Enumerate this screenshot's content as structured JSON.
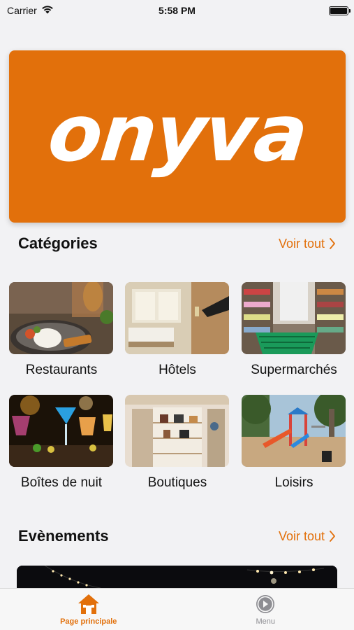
{
  "status_bar": {
    "carrier": "Carrier",
    "time": "5:58 PM"
  },
  "banner": {
    "logo_text": "onyva",
    "color": "#e2700b"
  },
  "categories_section": {
    "title": "Catégories",
    "see_all_label": "Voir tout",
    "items": [
      {
        "label": "Restaurants",
        "icon": "restaurant-photo"
      },
      {
        "label": "Hôtels",
        "icon": "hotel-photo"
      },
      {
        "label": "Supermarchés",
        "icon": "supermarket-photo"
      },
      {
        "label": "Boîtes de nuit",
        "icon": "nightclub-photo"
      },
      {
        "label": "Boutiques",
        "icon": "boutique-photo"
      },
      {
        "label": "Loisirs",
        "icon": "playground-photo"
      }
    ]
  },
  "events_section": {
    "title": "Evènements",
    "see_all_label": "Voir tout"
  },
  "tab_bar": {
    "tabs": [
      {
        "label": "Page principale",
        "icon": "home-icon",
        "active": true
      },
      {
        "label": "Menu",
        "icon": "menu-icon",
        "active": false
      }
    ]
  },
  "colors": {
    "accent": "#e2700b",
    "inactive_tab": "#8e8e93",
    "background": "#f2f2f4"
  }
}
